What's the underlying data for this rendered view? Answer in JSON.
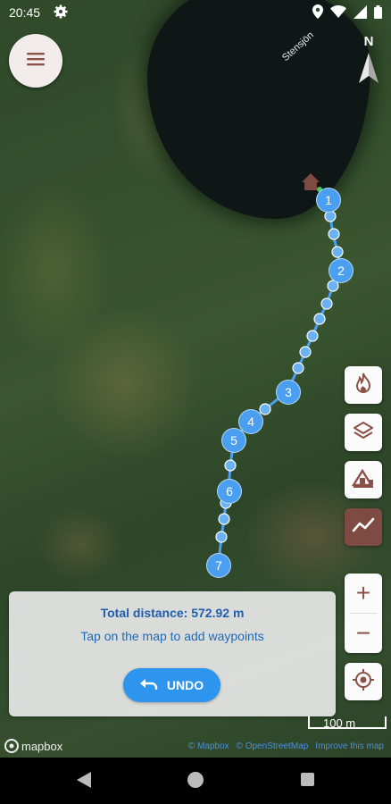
{
  "status_bar": {
    "time": "20:45"
  },
  "map": {
    "lake_name": "Stensjön",
    "compass_letter": "N",
    "scale_label": "100 m",
    "logo_text": "mapbox",
    "attribution": [
      "© Mapbox",
      "© OpenStreetMap",
      "Improve this map"
    ],
    "waypoint_labels": [
      "1",
      "2",
      "3",
      "4",
      "5",
      "6",
      "7"
    ],
    "route_color": "#4a9ff0"
  },
  "controls": {
    "menu": "hamburger-menu-icon",
    "fire": "fire-icon",
    "layers": "layers-icon",
    "shelter": "shelter-icon",
    "route_mode": "route-line-icon",
    "zoom_in": "+",
    "zoom_out": "−",
    "locate": "gps-locate-icon"
  },
  "panel": {
    "distance": "Total distance: 572.92 m",
    "hint": "Tap on the map to add waypoints",
    "undo_label": "UNDO"
  },
  "colors": {
    "accent": "#2e95ee",
    "brand": "#7f4a42",
    "text_blue": "#1f5fae"
  }
}
